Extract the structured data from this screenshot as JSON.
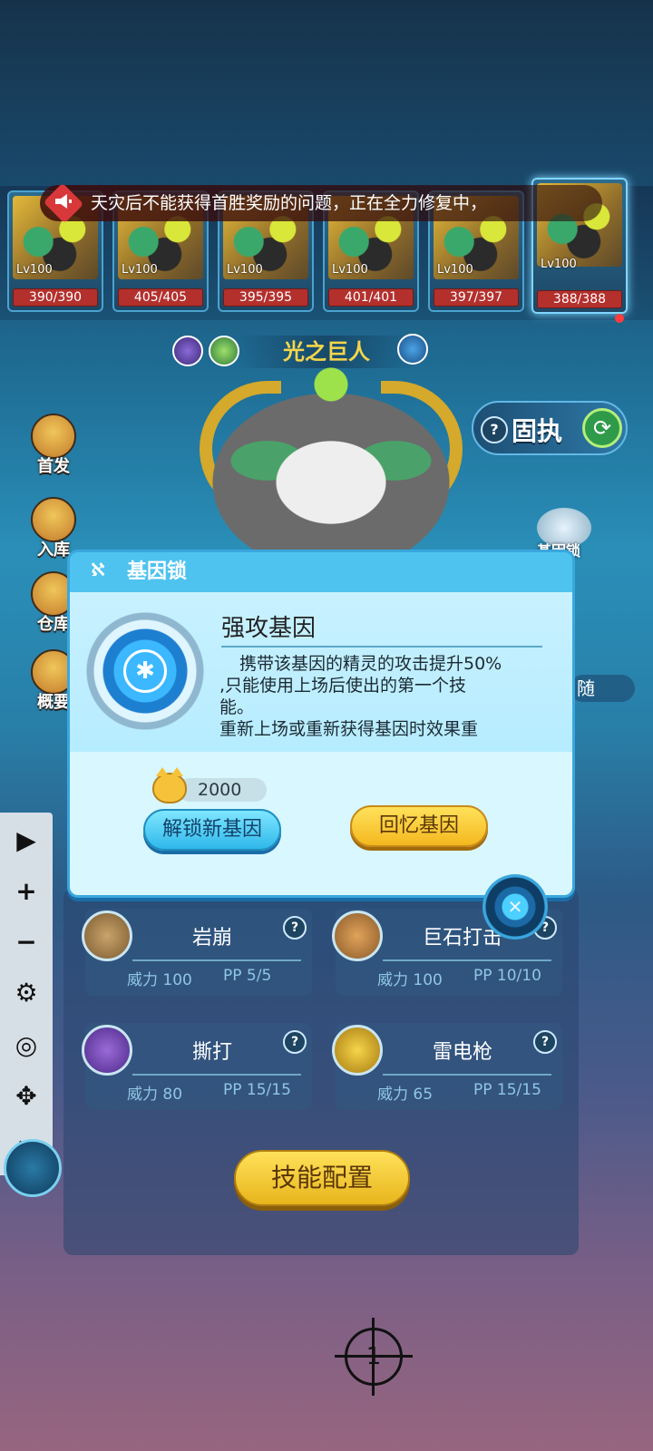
{
  "notice": {
    "text": "天灾后不能获得首胜奖励的问题，正在全力修复中，",
    "icon": "megaphone-icon"
  },
  "team": [
    {
      "level": "Lv100",
      "hp": "390/390"
    },
    {
      "level": "Lv100",
      "hp": "405/405"
    },
    {
      "level": "Lv100",
      "hp": "395/395"
    },
    {
      "level": "Lv100",
      "hp": "401/401"
    },
    {
      "level": "Lv100",
      "hp": "397/397"
    },
    {
      "level": "Lv100",
      "hp": "388/388",
      "selected": true
    }
  ],
  "pet": {
    "name": "光之巨人"
  },
  "trait_button": {
    "question": "?",
    "label": "固执",
    "refresh_icon": "refresh-icon"
  },
  "side_menu": [
    {
      "label": "首发",
      "icon": "starter-icon"
    },
    {
      "label": "入库",
      "icon": "store-icon"
    },
    {
      "label": "仓库",
      "icon": "warehouse-icon"
    },
    {
      "label": "概要",
      "icon": "summary-icon"
    }
  ],
  "right_menu": {
    "gene_lock_label": "基因锁",
    "follow_label": "随"
  },
  "modal": {
    "title": "基因锁",
    "gene_name": "强攻基因",
    "desc_line1": "携带该基因的精灵的攻击提升50%",
    "desc_line2": ",只能使用上场后使出的第一个技",
    "desc_line3": "能。",
    "desc_line4": "重新上场或重新获得基因时效果重",
    "cost": "2000",
    "unlock_label": "解锁新基因",
    "recall_label": "回忆基因",
    "close_icon": "close-icon"
  },
  "skills": [
    {
      "name": "岩崩",
      "power": "威力 100",
      "pp": "PP 5/5",
      "icon": "rock-icon"
    },
    {
      "name": "巨石打击",
      "power": "威力 100",
      "pp": "PP 10/10",
      "icon": "boulder-icon"
    },
    {
      "name": "撕打",
      "power": "威力 80",
      "pp": "PP 15/15",
      "icon": "bat-icon"
    },
    {
      "name": "雷电枪",
      "power": "威力 65",
      "pp": "PP 15/15",
      "icon": "lightning-icon"
    }
  ],
  "skill_question": "?",
  "config_button": "技能配置",
  "toolbar": {
    "play": "▶",
    "plus": "+",
    "minus": "−",
    "gear": "⚙",
    "eye": "◎",
    "move": "✥",
    "close": "✕"
  },
  "target_number": "1"
}
